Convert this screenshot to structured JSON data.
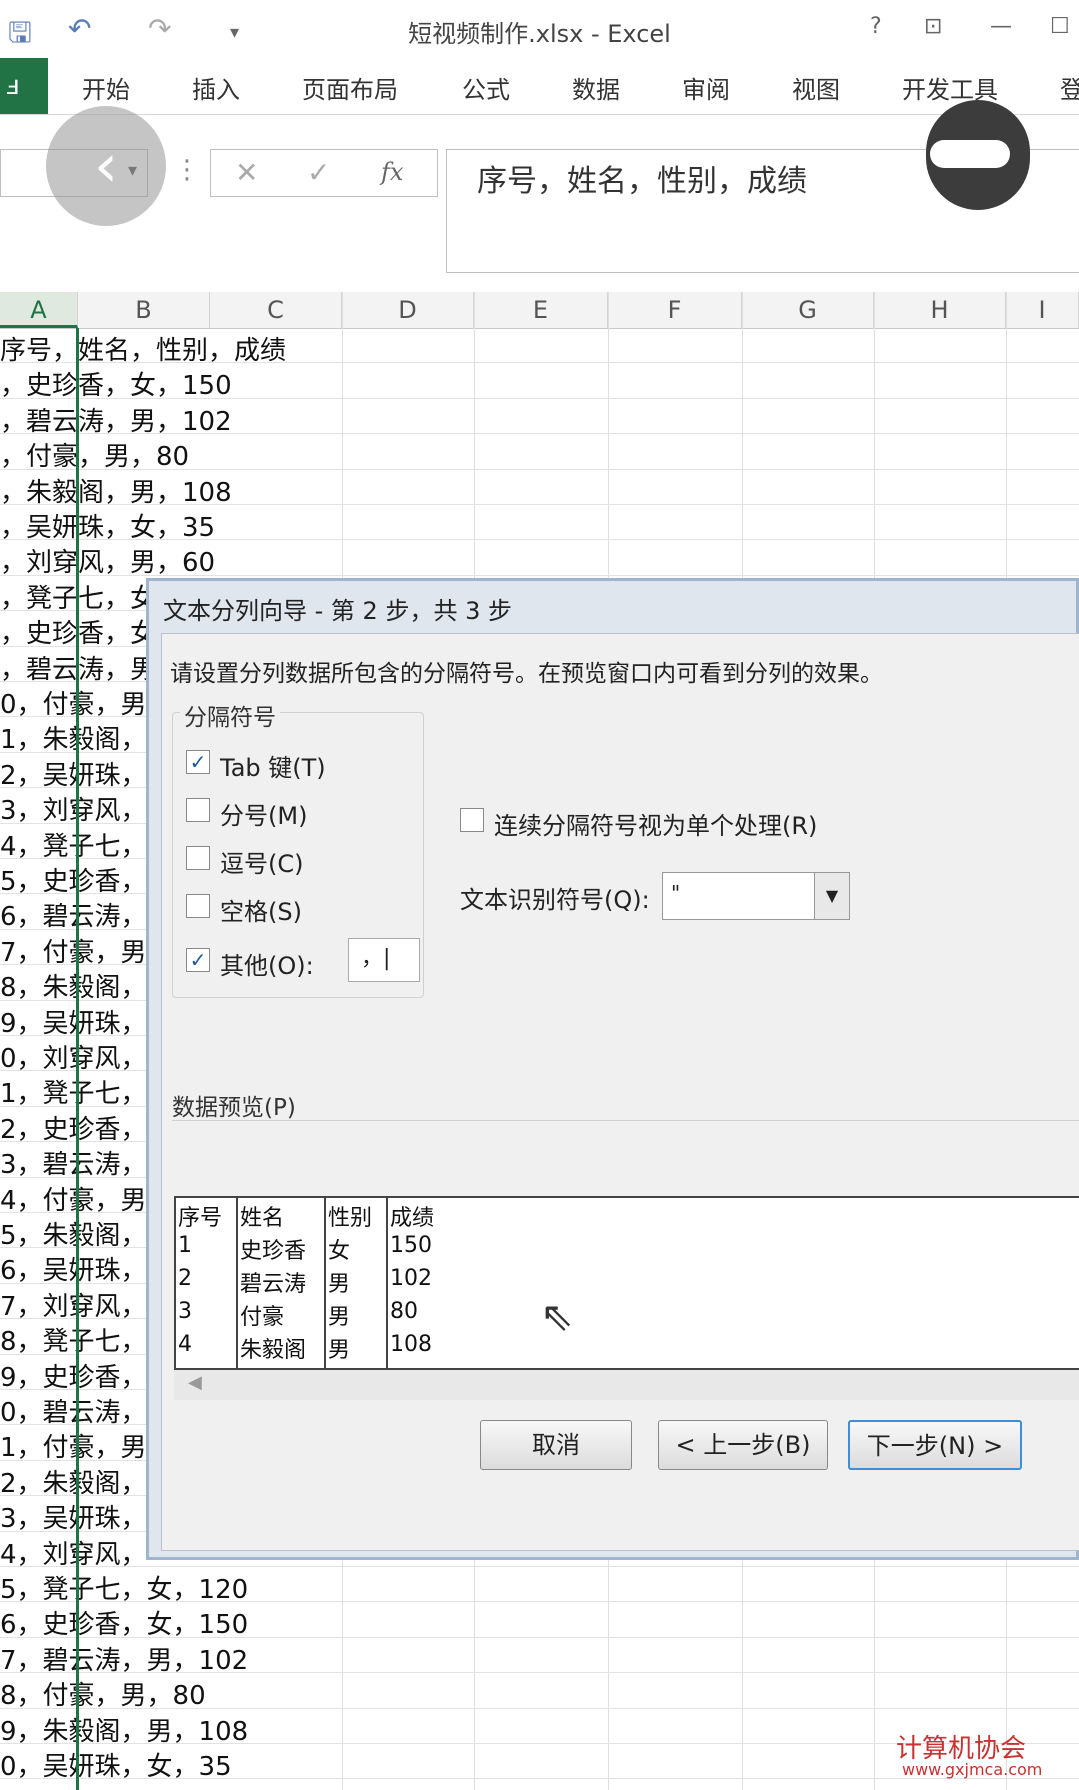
{
  "title_bar": {
    "title": "短视频制作.xlsx - Excel",
    "help": "?",
    "ribbon_display": "⊡",
    "minimize": "—",
    "restore": "☐"
  },
  "ribbon": {
    "file_tab": "ⅎ",
    "tabs": [
      "开始",
      "插入",
      "页面布局",
      "公式",
      "数据",
      "审阅",
      "视图",
      "开发工具",
      "登"
    ]
  },
  "formula_bar": {
    "name_box": "",
    "cancel": "✕",
    "enter": "✓",
    "fx": "fx",
    "content": "序号，姓名，性别，成绩"
  },
  "columns": [
    "A",
    "B",
    "C",
    "D",
    "E",
    "F",
    "G",
    "H",
    "I"
  ],
  "rows": [
    "序号，姓名，性别，成绩",
    "，史珍香，女，150",
    "，碧云涛，男，102",
    "，付豪，男，80",
    "，朱毅阁，男，108",
    "，吴妍珠，女，35",
    "，刘穿风，男，60",
    "，凳子七，女",
    "，史珍香，女",
    "，碧云涛，男",
    "0，付豪，男",
    "1，朱毅阁，",
    "2，吴妍珠，",
    "3，刘穿风，",
    "4，凳子七，",
    "5，史珍香，",
    "6，碧云涛，",
    "7，付豪，男",
    "8，朱毅阁，",
    "9，吴妍珠，",
    "0，刘穿风，",
    "1，凳子七，",
    "2，史珍香，",
    "3，碧云涛，",
    "4，付豪，男",
    "5，朱毅阁，",
    "6，吴妍珠，",
    "7，刘穿风，",
    "8，凳子七，",
    "9，史珍香，",
    "0，碧云涛，",
    "1，付豪，男",
    "2，朱毅阁，",
    "3，吴妍珠，",
    "4，刘穿风，",
    "5，凳子七，女，120",
    "6，史珍香，女，150",
    "7，碧云涛，男，102",
    "8，付豪，男，80",
    "9，朱毅阁，男，108",
    "0，吴妍珠，女，35"
  ],
  "dialog": {
    "title": "文本分列向导 - 第 2 步，共 3 步",
    "instruction": "请设置分列数据所包含的分隔符号。在预览窗口内可看到分列的效果。",
    "group_label": "分隔符号",
    "delimiters": [
      {
        "label": "Tab 键(T)",
        "checked": "✓"
      },
      {
        "label": "分号(M)",
        "checked": ""
      },
      {
        "label": "逗号(C)",
        "checked": ""
      },
      {
        "label": "空格(S)",
        "checked": ""
      },
      {
        "label": "其他(O):",
        "checked": "✓"
      }
    ],
    "other_value": "，|",
    "consecutive_label": "连续分隔符号视为单个处理(R)",
    "qualifier_label": "文本识别符号(Q):",
    "qualifier_value": "\"",
    "preview_label": "数据预览(P)",
    "preview_columns": [
      [
        "序号",
        "1",
        "2",
        "3",
        "4"
      ],
      [
        "姓名",
        "史珍香",
        "碧云涛",
        "付豪",
        "朱毅阁"
      ],
      [
        "性别",
        "女",
        "男",
        "男",
        "男"
      ],
      [
        "成绩",
        "150",
        "102",
        "80",
        "108"
      ]
    ],
    "buttons": {
      "cancel": "取消",
      "back": "< 上一步(B)",
      "next": "下一步(N) >"
    }
  },
  "watermark": {
    "main": "计算机协会",
    "sub": "www.gxjmca.com"
  }
}
